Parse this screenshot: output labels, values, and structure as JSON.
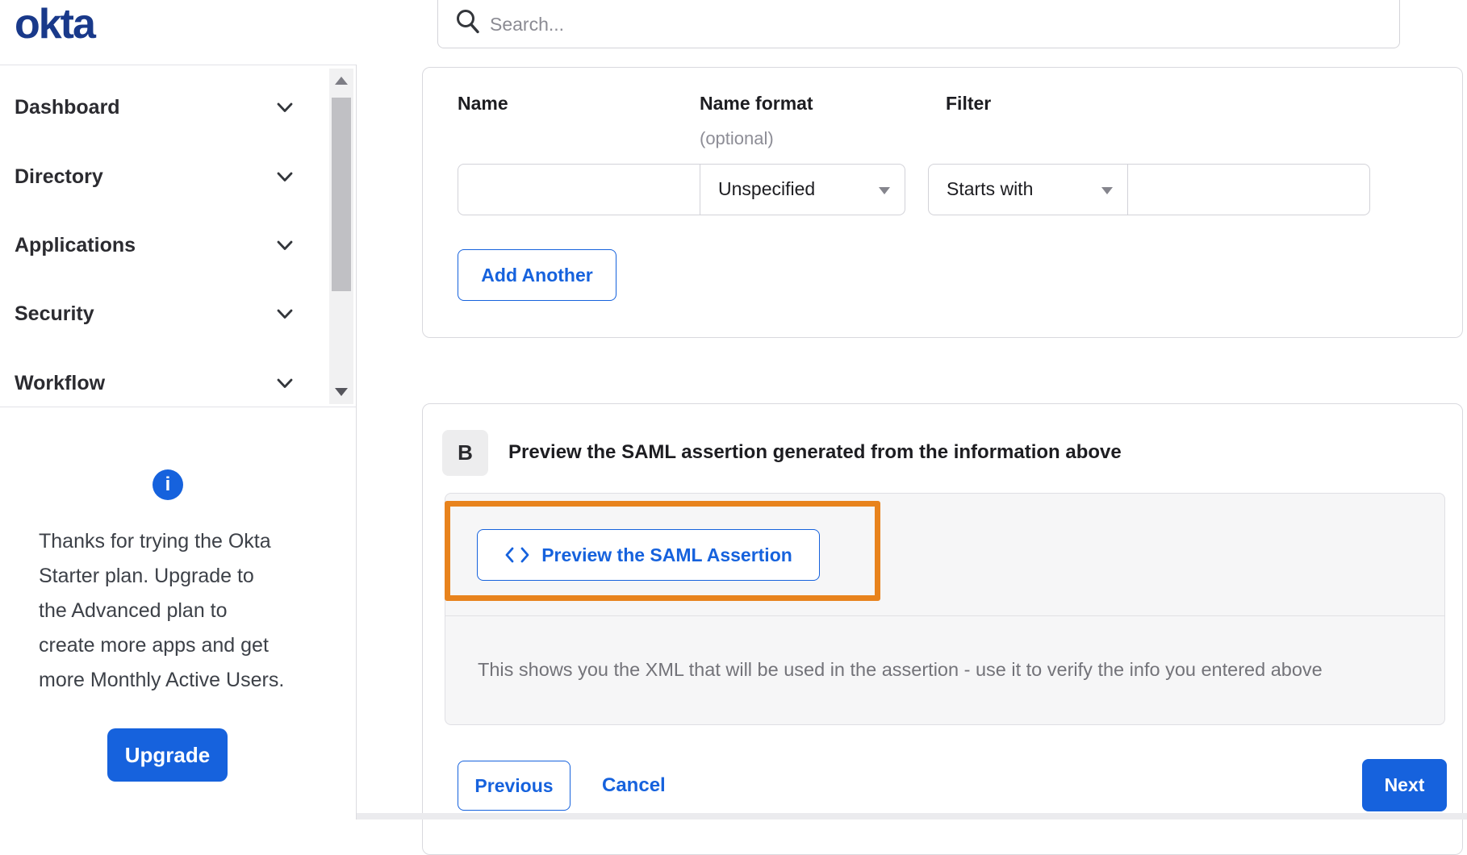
{
  "brand": {
    "logo": "okta"
  },
  "header": {
    "search_placeholder": "Search...",
    "search_value": ""
  },
  "sidebar": {
    "items": [
      {
        "label": "Dashboard"
      },
      {
        "label": "Directory"
      },
      {
        "label": "Applications"
      },
      {
        "label": "Security"
      },
      {
        "label": "Workflow"
      }
    ],
    "upsell": {
      "info_glyph": "i",
      "message": "Thanks for trying the Okta\nStarter plan. Upgrade to\nthe Advanced plan to\ncreate more apps and get\nmore Monthly Active Users.",
      "upgrade_label": "Upgrade"
    }
  },
  "attribute_form": {
    "name_label": "Name",
    "name_format_label": "Name format",
    "name_format_sublabel": "(optional)",
    "filter_label": "Filter",
    "name_value": "",
    "name_format_value": "Unspecified",
    "filter_operator_value": "Starts with",
    "filter_value": "",
    "add_another_label": "Add Another"
  },
  "preview_section": {
    "step_badge": "B",
    "heading": "Preview the SAML assertion generated from the information above",
    "preview_button_label": "Preview the SAML Assertion",
    "caption": "This shows you the XML that will be used in the assertion - use it to verify the info you entered above"
  },
  "footer": {
    "previous_label": "Previous",
    "cancel_label": "Cancel",
    "next_label": "Next"
  },
  "colors": {
    "primary_blue": "#1662dd",
    "logo_navy": "#19398a",
    "annotation_orange": "#e8831d"
  }
}
